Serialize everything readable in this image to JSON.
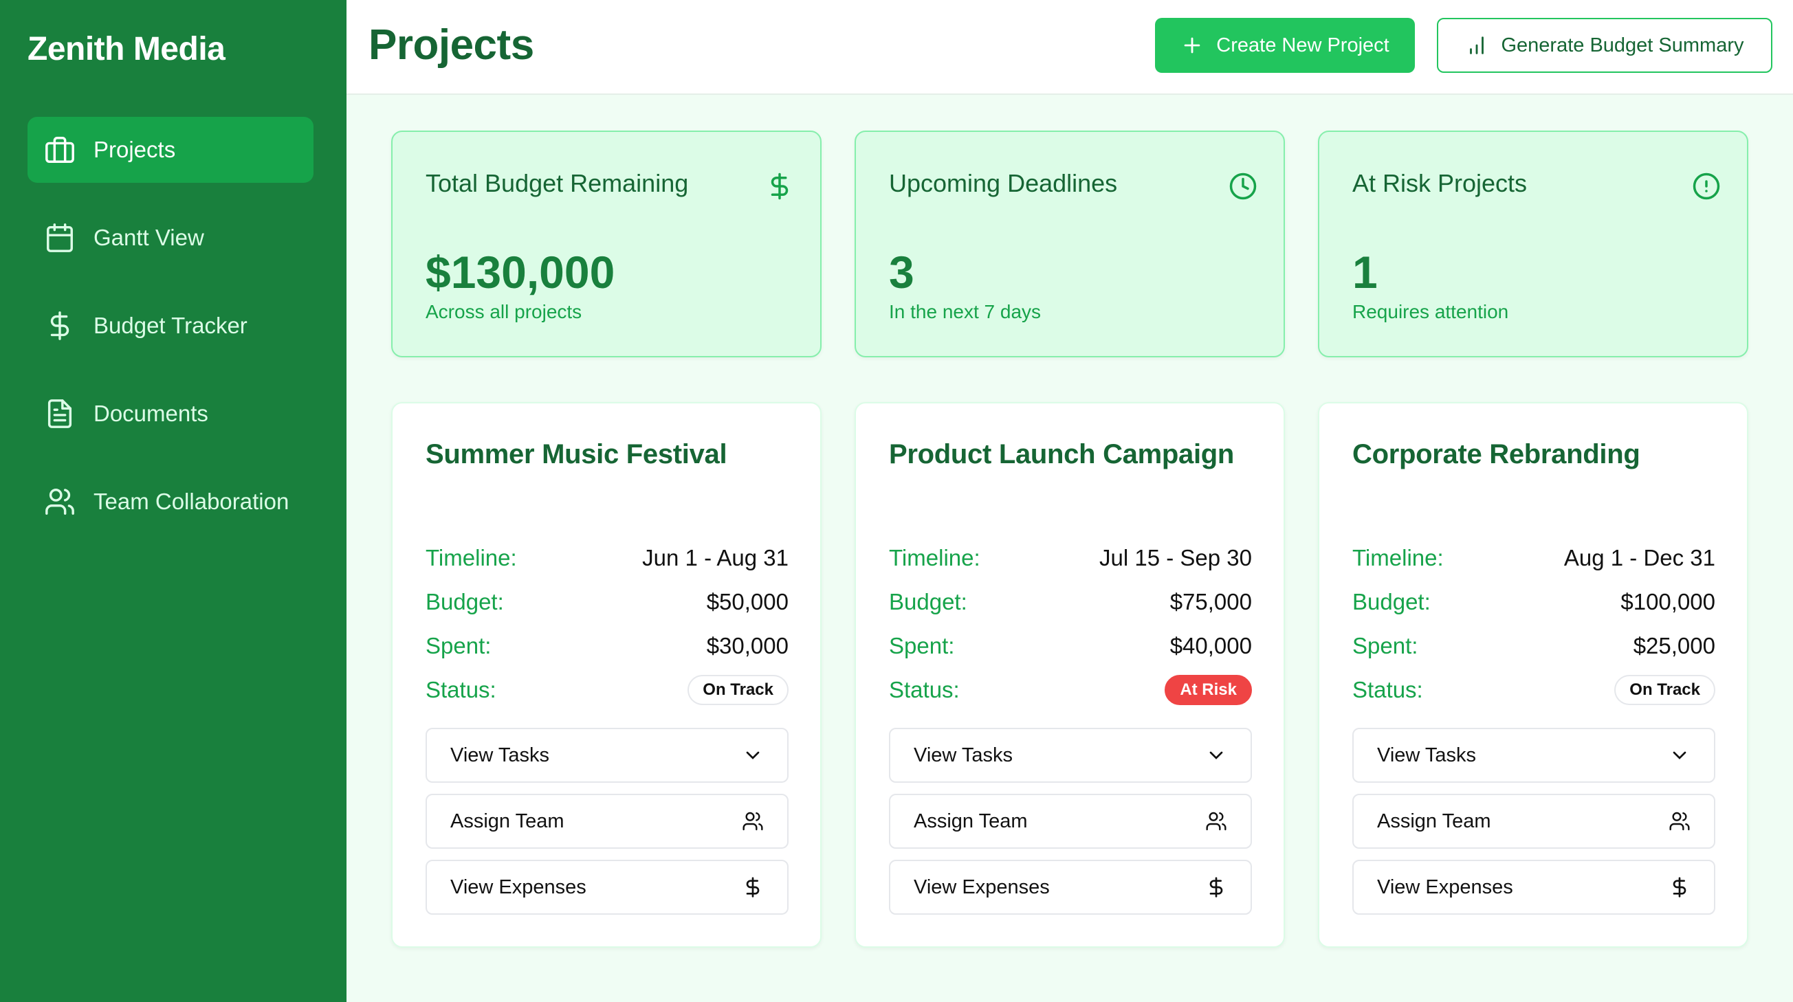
{
  "sidebar": {
    "brand": "Zenith Media",
    "items": [
      {
        "label": "Projects",
        "icon": "briefcase-icon",
        "active": true
      },
      {
        "label": "Gantt View",
        "icon": "calendar-icon",
        "active": false
      },
      {
        "label": "Budget Tracker",
        "icon": "dollar-icon",
        "active": false
      },
      {
        "label": "Documents",
        "icon": "document-icon",
        "active": false
      },
      {
        "label": "Team Collaboration",
        "icon": "users-icon",
        "active": false
      }
    ]
  },
  "header": {
    "title": "Projects",
    "create_label": "Create New Project",
    "summary_label": "Generate Budget Summary"
  },
  "stats": [
    {
      "title": "Total Budget Remaining",
      "value": "$130,000",
      "sub": "Across all projects",
      "icon": "dollar-icon"
    },
    {
      "title": "Upcoming Deadlines",
      "value": "3",
      "sub": "In the next 7 days",
      "icon": "clock-icon"
    },
    {
      "title": "At Risk Projects",
      "value": "1",
      "sub": "Requires attention",
      "icon": "alert-circle-icon"
    }
  ],
  "labels": {
    "timeline": "Timeline:",
    "budget": "Budget:",
    "spent": "Spent:",
    "status": "Status:",
    "view_tasks": "View Tasks",
    "assign_team": "Assign Team",
    "view_expenses": "View Expenses"
  },
  "projects": [
    {
      "name": "Summer Music Festival",
      "timeline": "Jun 1 - Aug 31",
      "budget": "$50,000",
      "spent": "$30,000",
      "status": "On Track"
    },
    {
      "name": "Product Launch Campaign",
      "timeline": "Jul 15 - Sep 30",
      "budget": "$75,000",
      "spent": "$40,000",
      "status": "At Risk"
    },
    {
      "name": "Corporate Rebranding",
      "timeline": "Aug 1 - Dec 31",
      "budget": "$100,000",
      "spent": "$25,000",
      "status": "On Track"
    }
  ],
  "colors": {
    "sidebar": "#19803d",
    "accent": "#22c55e",
    "risk": "#ef4444",
    "stat_bg": "#dcfce7"
  }
}
